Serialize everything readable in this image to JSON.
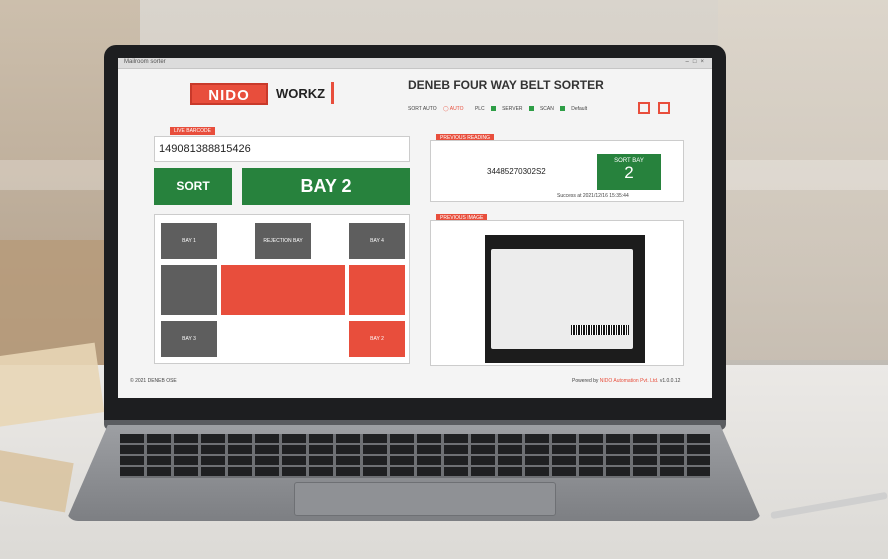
{
  "window": {
    "title": "Mailroom sorter"
  },
  "header": {
    "logo_text": "NIDO",
    "brand_suffix": "WORKZ",
    "app_title": "DENEB FOUR WAY BELT SORTER",
    "status": [
      "SORT AUTO",
      "AUTO",
      "PLC",
      "SERVER",
      "SCAN",
      "Default"
    ],
    "icons": [
      "settings-icon",
      "close-icon"
    ]
  },
  "live_barcode": {
    "label": "LIVE BARCODE",
    "value": "149081388815426"
  },
  "sort_button": "SORT",
  "current_bay": "BAY 2",
  "diagram": {
    "bays": {
      "bay1": "BAY 1",
      "rejection": "REJECTION BAY",
      "bay4": "BAY 4",
      "bay3": "BAY 3",
      "bay2": "BAY 2"
    }
  },
  "previous_reading": {
    "label": "PREVIOUS READING",
    "code": "34485270302S2",
    "sort_bay_label": "SORT BAY",
    "sort_bay_value": "2",
    "success_text": "Success at   2021/12/16 15:35:44"
  },
  "previous_image": {
    "label": "PREVIOUS IMAGE"
  },
  "footer": {
    "left": "© 2021 DENEB OSE",
    "right_prefix": "Powered by",
    "right_brand": "NIDO Automation Pvt. Ltd.",
    "version": "v1.0.0.12"
  },
  "colors": {
    "brand_red": "#e84e3c",
    "ok_green": "#27823d",
    "bay_gray": "#5e5e5e"
  }
}
